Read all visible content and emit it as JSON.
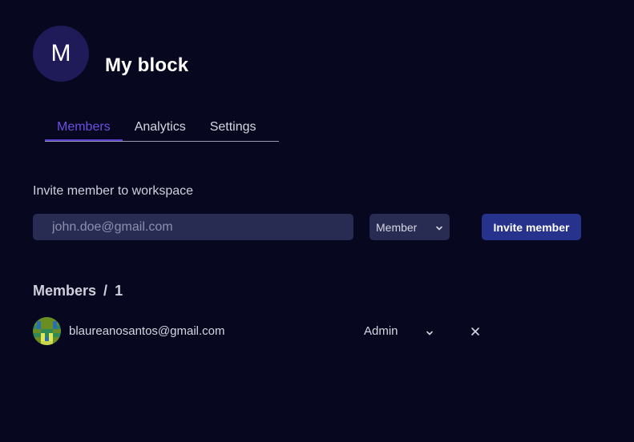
{
  "workspace": {
    "avatar_letter": "M",
    "title": "My block"
  },
  "tabs": [
    {
      "label": "Members",
      "active": true
    },
    {
      "label": "Analytics",
      "active": false
    },
    {
      "label": "Settings",
      "active": false
    }
  ],
  "invite": {
    "label": "Invite member to workspace",
    "email_placeholder": "john.doe@gmail.com",
    "email_value": "",
    "role_selected": "Member",
    "button_label": "Invite member"
  },
  "members": {
    "heading": "Members",
    "separator": "/",
    "count": "1",
    "items": [
      {
        "email": "blaureanosantos@gmail.com",
        "role": "Admin",
        "avatar_icon": "pixel-identicon-icon"
      }
    ]
  },
  "colors": {
    "background": "#070720",
    "accent_tab": "#6c4fe0",
    "button": "#26328c",
    "input_bg": "#282c52",
    "avatar_bg": "#1f1a58"
  }
}
